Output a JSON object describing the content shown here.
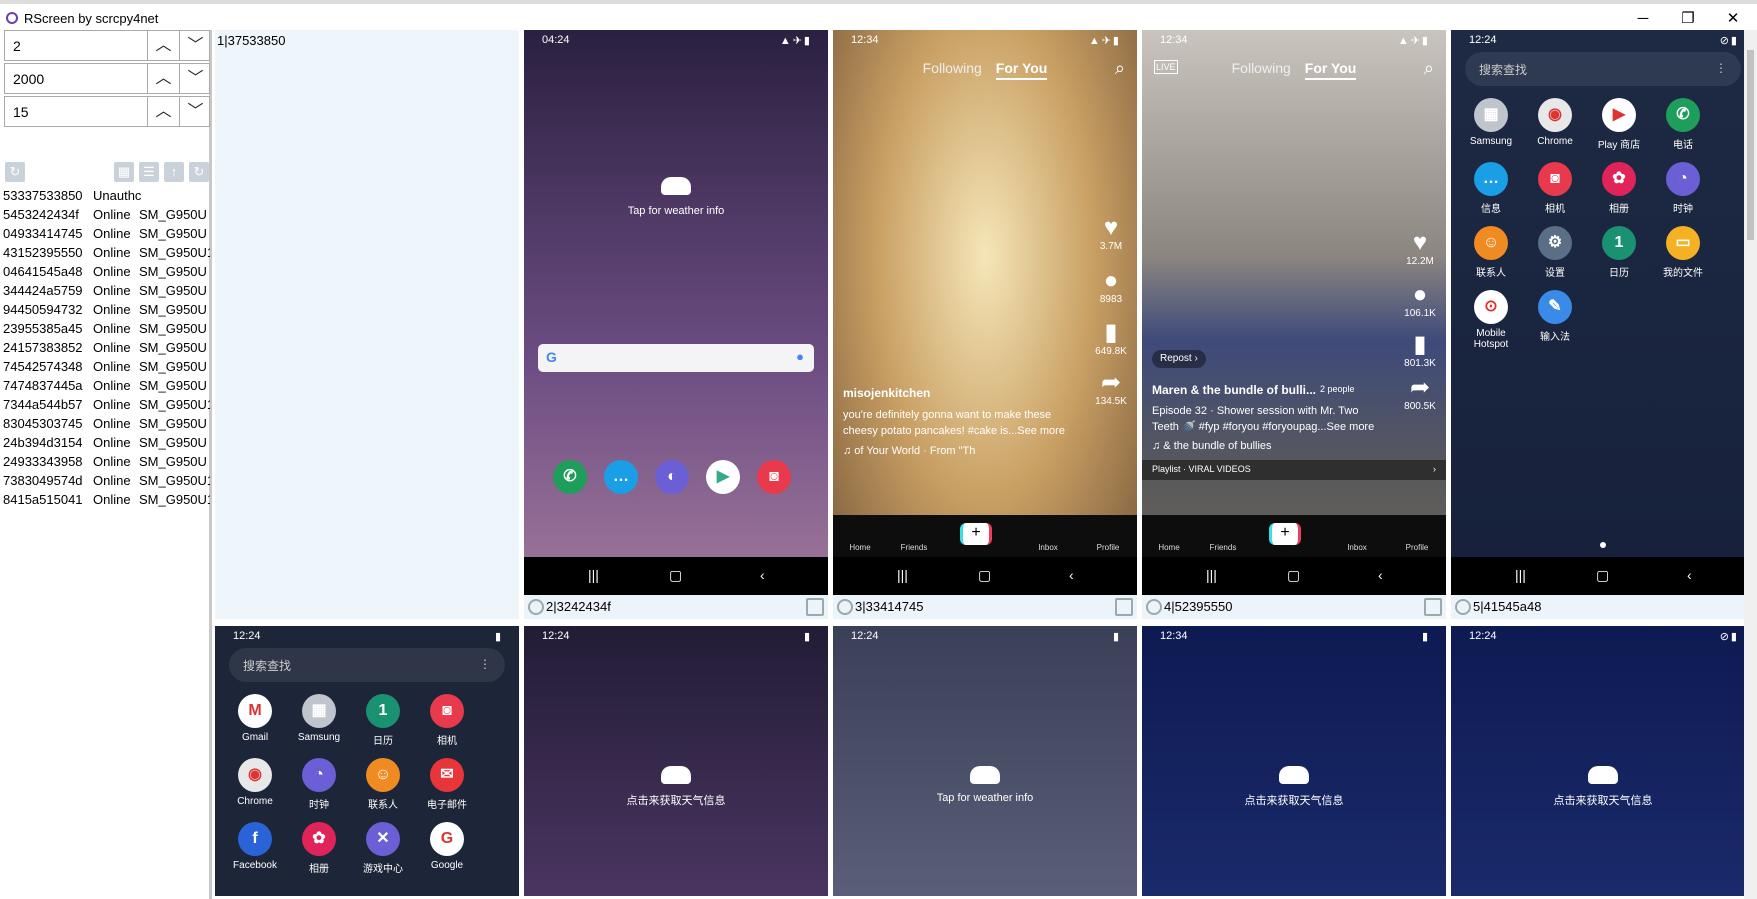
{
  "window": {
    "title": "RScreen by scrcpy4net"
  },
  "controls": {
    "spin1": "2",
    "spin2": "2000",
    "spin3": "15"
  },
  "devices": [
    {
      "id": "53337533850",
      "status": "Unauthc",
      "model": ""
    },
    {
      "id": "5453242434f",
      "status": "Online",
      "model": "SM_G950U"
    },
    {
      "id": "04933414745",
      "status": "Online",
      "model": "SM_G950U"
    },
    {
      "id": "43152395550",
      "status": "Online",
      "model": "SM_G950U1"
    },
    {
      "id": "04641545a48",
      "status": "Online",
      "model": "SM_G950U"
    },
    {
      "id": "344424a5759",
      "status": "Online",
      "model": "SM_G950U"
    },
    {
      "id": "94450594732",
      "status": "Online",
      "model": "SM_G950U"
    },
    {
      "id": "23955385a45",
      "status": "Online",
      "model": "SM_G950U"
    },
    {
      "id": "24157383852",
      "status": "Online",
      "model": "SM_G950U"
    },
    {
      "id": "74542574348",
      "status": "Online",
      "model": "SM_G950U"
    },
    {
      "id": "7474837445a",
      "status": "Online",
      "model": "SM_G950U"
    },
    {
      "id": "7344a544b57",
      "status": "Online",
      "model": "SM_G950U1"
    },
    {
      "id": "83045303745",
      "status": "Online",
      "model": "SM_G950U"
    },
    {
      "id": "24b394d3154",
      "status": "Online",
      "model": "SM_G950U"
    },
    {
      "id": "24933343958",
      "status": "Online",
      "model": "SM_G950U"
    },
    {
      "id": "7383049574d",
      "status": "Online",
      "model": "SM_G950U1"
    },
    {
      "id": "8415a515041",
      "status": "Online",
      "model": "SM_G950U1"
    }
  ],
  "cells": {
    "c1": {
      "label": "1|37533850"
    },
    "c2": {
      "label": "2|3242434f",
      "time": "04:24",
      "weather": "Tap for weather info"
    },
    "c3": {
      "label": "3|33414745",
      "time": "12:34",
      "following": "Following",
      "foryou": "For You",
      "likes": "3.7M",
      "comments": "8983",
      "saves": "649.8K",
      "shares": "134.5K",
      "user": "misojenkitchen",
      "desc1": "you're definitely gonna want to make these",
      "desc2": "cheesy potato pancakes! #cake is...See more",
      "music": "♫ of Your World · From \"Th"
    },
    "c4": {
      "label": "4|52395550",
      "time": "12:34",
      "following": "Following",
      "foryou": "For You",
      "likes": "12.2M",
      "comments": "106.1K",
      "saves": "801.3K",
      "shares": "800.5K",
      "repost": "Repost",
      "user": "Maren & the bundle of bulli...",
      "people": "2 people",
      "desc1": "Episode 32 · Shower session with Mr. Two",
      "desc2": "Teeth 🚿 #fyp #foryou #foryoupag...See more",
      "music": "♫ & the bundle of bullies",
      "playlist": "Playlist · VIRAL VIDEOS"
    },
    "c5": {
      "label": "5|41545a48",
      "time": "12:24",
      "search": "搜索查找"
    },
    "c6": {
      "time": "12:24",
      "search": "搜索查找"
    },
    "c7": {
      "time": "12:24",
      "weather": "点击来获取天气信息"
    },
    "c8": {
      "time": "12:24",
      "weather": "Tap for weather info"
    },
    "c9": {
      "time": "12:34",
      "weather": "点击来获取天气信息"
    },
    "c10": {
      "time": "12:24",
      "weather": "点击来获取天气信息"
    }
  },
  "tiktok_tabs": [
    "Home",
    "Friends",
    "Inbox",
    "Profile"
  ],
  "home_apps": [
    {
      "name": "Samsung",
      "color": "#c0c4cc",
      "g": "▦"
    },
    {
      "name": "Chrome",
      "color": "#e8e8e8",
      "g": "◉"
    },
    {
      "name": "Play 商店",
      "color": "#ffffff",
      "g": "▶"
    },
    {
      "name": "电话",
      "color": "#1e9e5a",
      "g": "✆"
    },
    {
      "name": "信息",
      "color": "#1a9ee6",
      "g": "…"
    },
    {
      "name": "相机",
      "color": "#e83a4c",
      "g": "◙"
    },
    {
      "name": "相册",
      "color": "#e0245a",
      "g": "✿"
    },
    {
      "name": "时钟",
      "color": "#6b5fd6",
      "g": "◔"
    },
    {
      "name": "联系人",
      "color": "#f08a22",
      "g": "☺"
    },
    {
      "name": "设置",
      "color": "#5a6e86",
      "g": "⚙"
    },
    {
      "name": "日历",
      "color": "#1a9170",
      "g": "1"
    },
    {
      "name": "我的文件",
      "color": "#f4b123",
      "g": "▭"
    },
    {
      "name": "Mobile Hotspot",
      "color": "#ffffff",
      "g": "⊙"
    },
    {
      "name": "输入法",
      "color": "#3a8be8",
      "g": "✎"
    }
  ],
  "home_apps2": [
    {
      "name": "Gmail",
      "color": "#ffffff",
      "g": "M"
    },
    {
      "name": "Samsung",
      "color": "#c0c4cc",
      "g": "▦"
    },
    {
      "name": "日历",
      "color": "#1a9170",
      "g": "1"
    },
    {
      "name": "相机",
      "color": "#e83a4c",
      "g": "◙"
    },
    {
      "name": "Chrome",
      "color": "#e8e8e8",
      "g": "◉"
    },
    {
      "name": "时钟",
      "color": "#6b5fd6",
      "g": "◔"
    },
    {
      "name": "联系人",
      "color": "#f08a22",
      "g": "☺"
    },
    {
      "name": "电子邮件",
      "color": "#e8353a",
      "g": "✉"
    },
    {
      "name": "Facebook",
      "color": "#2a63d6",
      "g": "f"
    },
    {
      "name": "相册",
      "color": "#e0245a",
      "g": "✿"
    },
    {
      "name": "游戏中心",
      "color": "#6b5fd6",
      "g": "✕"
    },
    {
      "name": "Google",
      "color": "#ffffff",
      "g": "G"
    }
  ]
}
